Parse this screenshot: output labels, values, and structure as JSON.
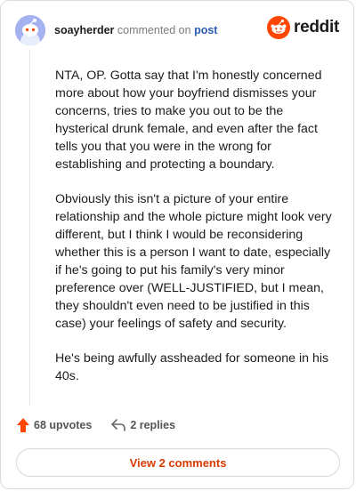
{
  "header": {
    "username": "soayherder",
    "action_text": "commented on",
    "post_link": "post",
    "logo_text": "reddit",
    "brand_color": "#ff4500",
    "avatar_icon": "snoo-avatar-icon"
  },
  "comment": {
    "paragraphs": [
      "NTA, OP. Gotta say that I'm honestly concerned more about how your boyfriend dismisses your concerns, tries to make you out to be the hysterical drunk female, and even after the fact tells you that you were in the wrong for establishing and protecting a boundary.",
      "Obviously this isn't a picture of your entire relationship and the whole picture might look very different, but I think I would be reconsidering whether this is a person I want to date, especially if he's going to put his family's very minor preference over (WELL-JUSTIFIED, but I mean, they shouldn't even need to be justified in this case) your feelings of safety and security.",
      "He's being awfully assheaded for someone in his 40s."
    ]
  },
  "actions": {
    "upvotes": "68 upvotes",
    "replies": "2 replies",
    "upvote_icon": "upvote-arrow-icon",
    "reply_icon": "reply-arrow-icon"
  },
  "footer": {
    "view_comments_label": "View 2 comments",
    "accent_color": "#d93a00"
  }
}
